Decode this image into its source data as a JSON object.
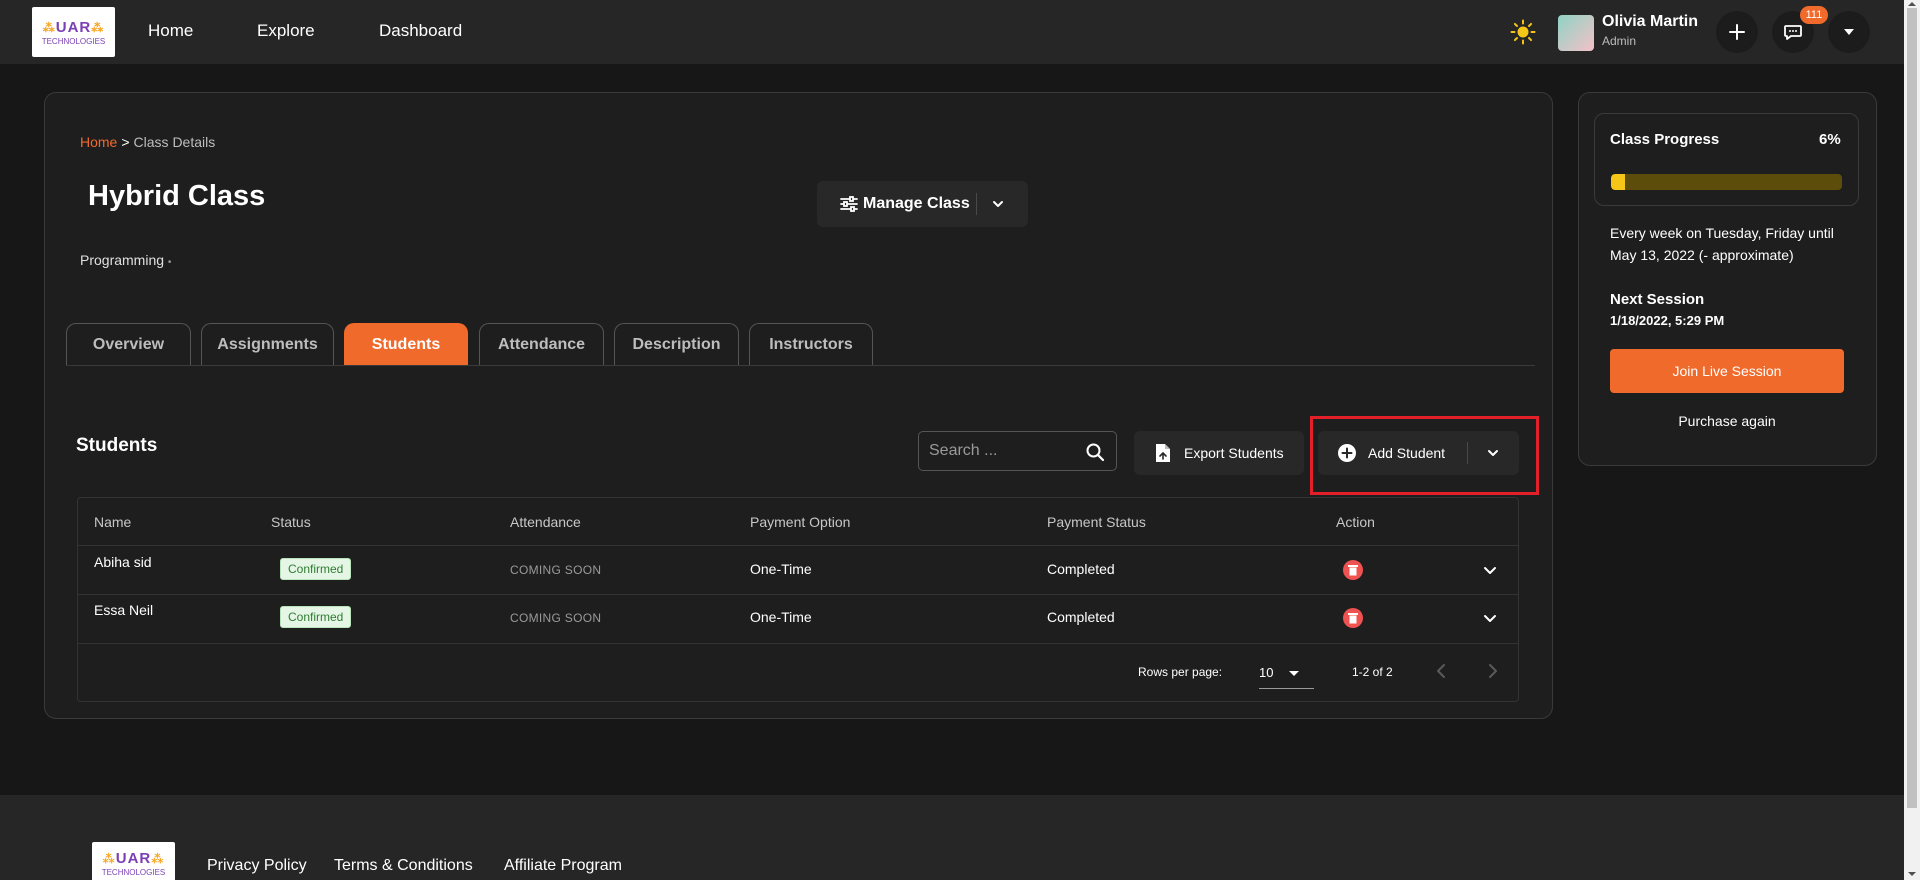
{
  "brand": {
    "logo_text": "UAR",
    "logo_sub": "TECHNOLOGIES"
  },
  "nav": {
    "links": [
      "Home",
      "Explore",
      "Dashboard"
    ]
  },
  "user": {
    "name": "Olivia Martin",
    "role": "Admin",
    "notifications": "111"
  },
  "breadcrumb": {
    "home": "Home",
    "separator": ">",
    "current": "Class Details"
  },
  "class": {
    "title": "Hybrid Class",
    "category": "Programming",
    "category_dot": "•"
  },
  "manage": {
    "label": "Manage Class"
  },
  "tabs": [
    {
      "label": "Overview",
      "active": false
    },
    {
      "label": "Assignments",
      "active": false
    },
    {
      "label": "Students",
      "active": true
    },
    {
      "label": "Attendance",
      "active": false
    },
    {
      "label": "Description",
      "active": false
    },
    {
      "label": "Instructors",
      "active": false
    }
  ],
  "students": {
    "title": "Students",
    "search_placeholder": "Search ...",
    "export_label": "Export Students",
    "add_label": "Add Student",
    "columns": [
      "Name",
      "Status",
      "Attendance",
      "Payment Option",
      "Payment Status",
      "Action"
    ],
    "rows": [
      {
        "name": "Abiha sid",
        "status": "Confirmed",
        "attendance": "COMING SOON",
        "payment_option": "One-Time",
        "payment_status": "Completed"
      },
      {
        "name": "Essa Neil",
        "status": "Confirmed",
        "attendance": "COMING SOON",
        "payment_option": "One-Time",
        "payment_status": "Completed"
      }
    ],
    "pagination": {
      "rows_label": "Rows per page:",
      "rows_value": "10",
      "range": "1-2 of 2"
    }
  },
  "progress": {
    "label": "Class Progress",
    "percent_label": "6%",
    "fraction": 0.06,
    "schedule": "Every week on Tuesday, Friday until May 13, 2022 (- approximate)",
    "next_label": "Next Session",
    "next_value": "1/18/2022, 5:29 PM",
    "join_label": "Join Live Session",
    "purchase_label": "Purchase again"
  },
  "footer": {
    "links": [
      "Privacy Policy",
      "Terms & Conditions",
      "Affiliate Program"
    ]
  },
  "colors": {
    "accent": "#f06a2b",
    "progress_fill": "#f5c518",
    "progress_track": "#5c4e0a",
    "highlight": "#e3202a",
    "confirmed_bg": "#e6f6e6",
    "confirmed_text": "#2e7d32"
  }
}
